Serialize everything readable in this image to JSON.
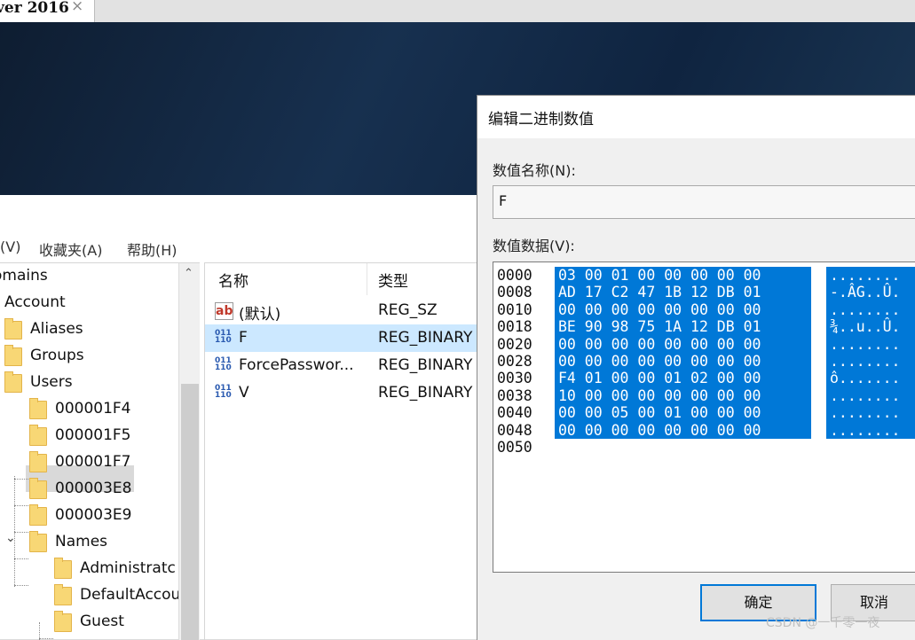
{
  "tab": {
    "title": "ver 2016",
    "close": "×"
  },
  "menu": [
    "(V)",
    "收藏夹(A)",
    "帮助(H)"
  ],
  "tree": [
    {
      "label": "omains"
    },
    {
      "label": "Account"
    },
    {
      "label": "Aliases"
    },
    {
      "label": "Groups"
    },
    {
      "label": "Users"
    },
    {
      "label": "000001F4"
    },
    {
      "label": "000001F5"
    },
    {
      "label": "000001F7"
    },
    {
      "label": "000003E8"
    },
    {
      "label": "000003E9"
    },
    {
      "label": "Names"
    },
    {
      "label": "Administratc"
    },
    {
      "label": "DefaultAccou"
    },
    {
      "label": "Guest"
    }
  ],
  "list": {
    "col_name": "名称",
    "col_type": "类型",
    "rows": [
      {
        "name": "(默认)",
        "type": "REG_SZ",
        "icon": "string-value-icon"
      },
      {
        "name": "F",
        "type": "REG_BINARY",
        "icon": "binary-value-icon"
      },
      {
        "name": "ForcePasswor...",
        "type": "REG_BINARY",
        "icon": "binary-value-icon"
      },
      {
        "name": "V",
        "type": "REG_BINARY",
        "icon": "binary-value-icon"
      }
    ]
  },
  "dialog": {
    "title": "编辑二进制数值",
    "name_label": "数值名称(N):",
    "name_value": "F",
    "data_label": "数值数据(V):",
    "offsets": [
      "0000",
      "0008",
      "0010",
      "0018",
      "0020",
      "0028",
      "0030",
      "0038",
      "0040",
      "0048",
      "0050"
    ],
    "bytes": [
      "03 00 01 00 00 00 00 00",
      "AD 17 C2 47 1B 12 DB 01",
      "00 00 00 00 00 00 00 00",
      "BE 90 98 75 1A 12 DB 01",
      "00 00 00 00 00 00 00 00",
      "00 00 00 00 00 00 00 00",
      "F4 01 00 00 01 02 00 00",
      "10 00 00 00 00 00 00 00",
      "00 00 05 00 01 00 00 00",
      "00 00 00 00 00 00 00 00"
    ],
    "ascii": [
      "........",
      "-.ÂG..Û.",
      "........",
      "¾..u..Û.",
      "........",
      "........",
      "ô.......",
      "........",
      "........",
      "........"
    ],
    "ok_label": "确定",
    "cancel_label": "取消"
  },
  "watermark": "CSDN @一千零一夜"
}
